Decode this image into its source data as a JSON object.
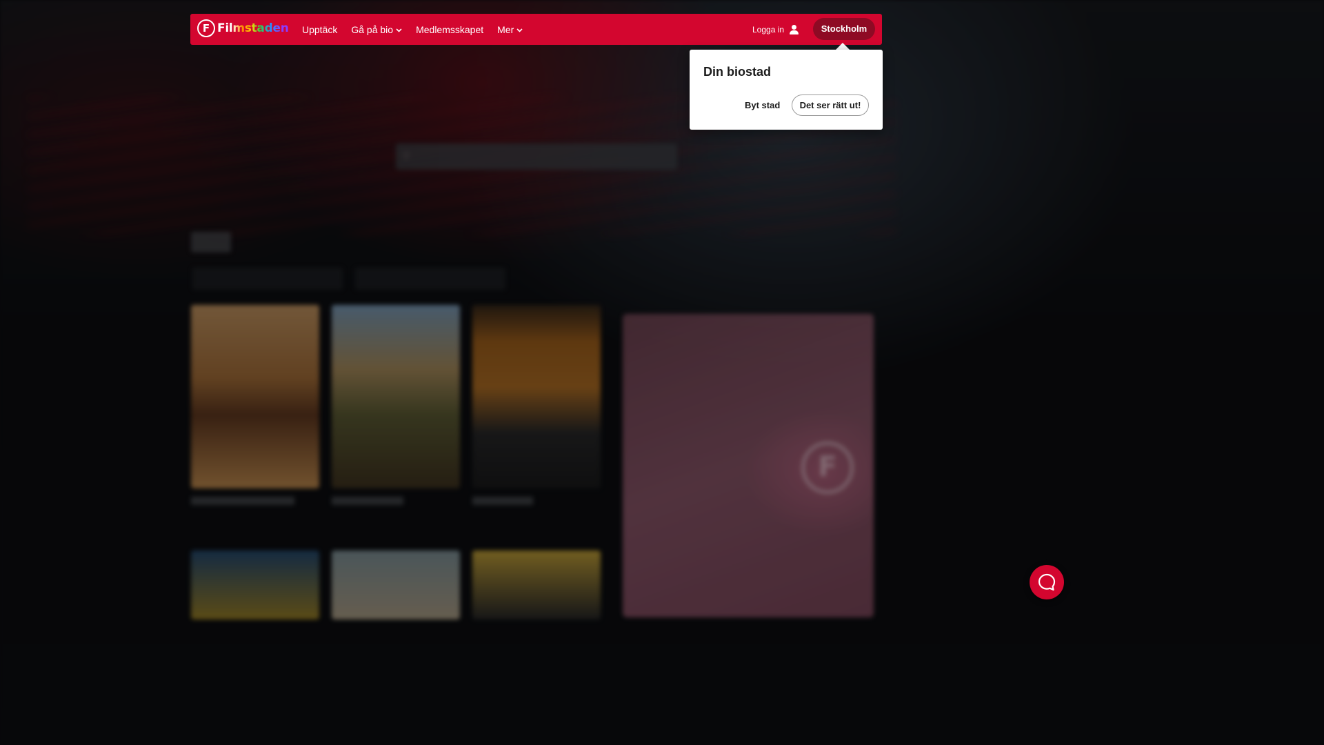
{
  "header": {
    "logo_text": "Filmstaden",
    "logo_letter": "F",
    "nav": [
      {
        "label": "Upptäck",
        "has_dropdown": false
      },
      {
        "label": "Gå på bio",
        "has_dropdown": true
      },
      {
        "label": "Medlemsskapet",
        "has_dropdown": false
      },
      {
        "label": "Mer",
        "has_dropdown": true
      }
    ],
    "login_label": "Logga in",
    "city_button": "Stockholm"
  },
  "popover": {
    "title": "Din biostad",
    "change_city": "Byt stad",
    "confirm": "Det ser rätt ut!"
  },
  "colors": {
    "brand_red": "#d3062f",
    "city_button_bg": "#8e0a24"
  },
  "icons": {
    "user": "user-icon",
    "chat": "chat-icon",
    "chevron": "chevron-down-icon"
  }
}
